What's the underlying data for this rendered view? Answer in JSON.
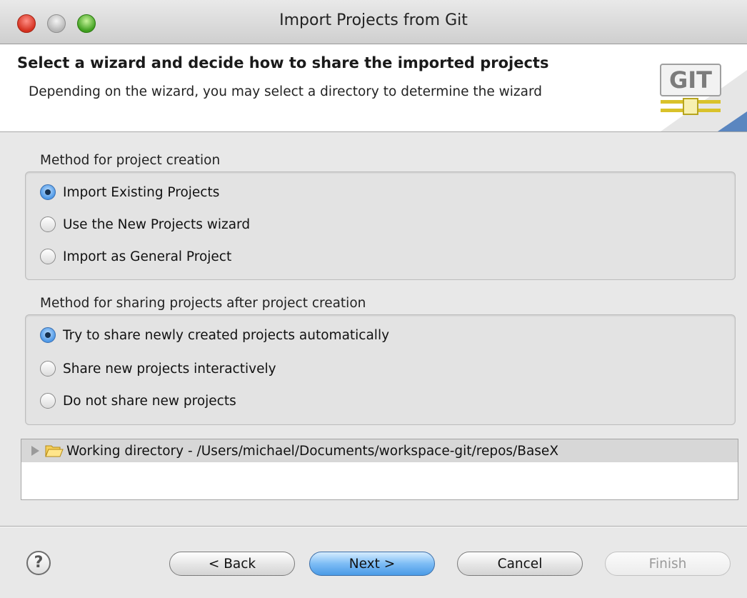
{
  "window": {
    "title": "Import Projects from Git"
  },
  "header": {
    "title": "Select a wizard and decide how to share the imported projects",
    "description": "Depending on the wizard, you may select a directory to determine the wizard",
    "logo_text": "GIT"
  },
  "creation_group": {
    "label": "Method for project creation",
    "options": [
      {
        "label": "Import Existing Projects",
        "selected": true
      },
      {
        "label": "Use the New Projects wizard",
        "selected": false
      },
      {
        "label": "Import as General Project",
        "selected": false
      }
    ]
  },
  "sharing_group": {
    "label": "Method for sharing projects after project creation",
    "options": [
      {
        "label": "Try to share newly created projects automatically",
        "selected": true
      },
      {
        "label": "Share new projects interactively",
        "selected": false
      },
      {
        "label": "Do not share new projects",
        "selected": false
      }
    ]
  },
  "tree": {
    "items": [
      {
        "label": "Working directory - /Users/michael/Documents/workspace-git/repos/BaseX",
        "icon": "folder-icon",
        "expanded": false
      }
    ]
  },
  "buttons": {
    "help": "?",
    "back": "< Back",
    "next": "Next >",
    "cancel": "Cancel",
    "finish": "Finish"
  },
  "colors": {
    "header_bg": "#ffffff",
    "dialog_bg": "#e8e8e8",
    "primary_button": "#6aaee8",
    "selected_radio": "#4d97e6"
  }
}
